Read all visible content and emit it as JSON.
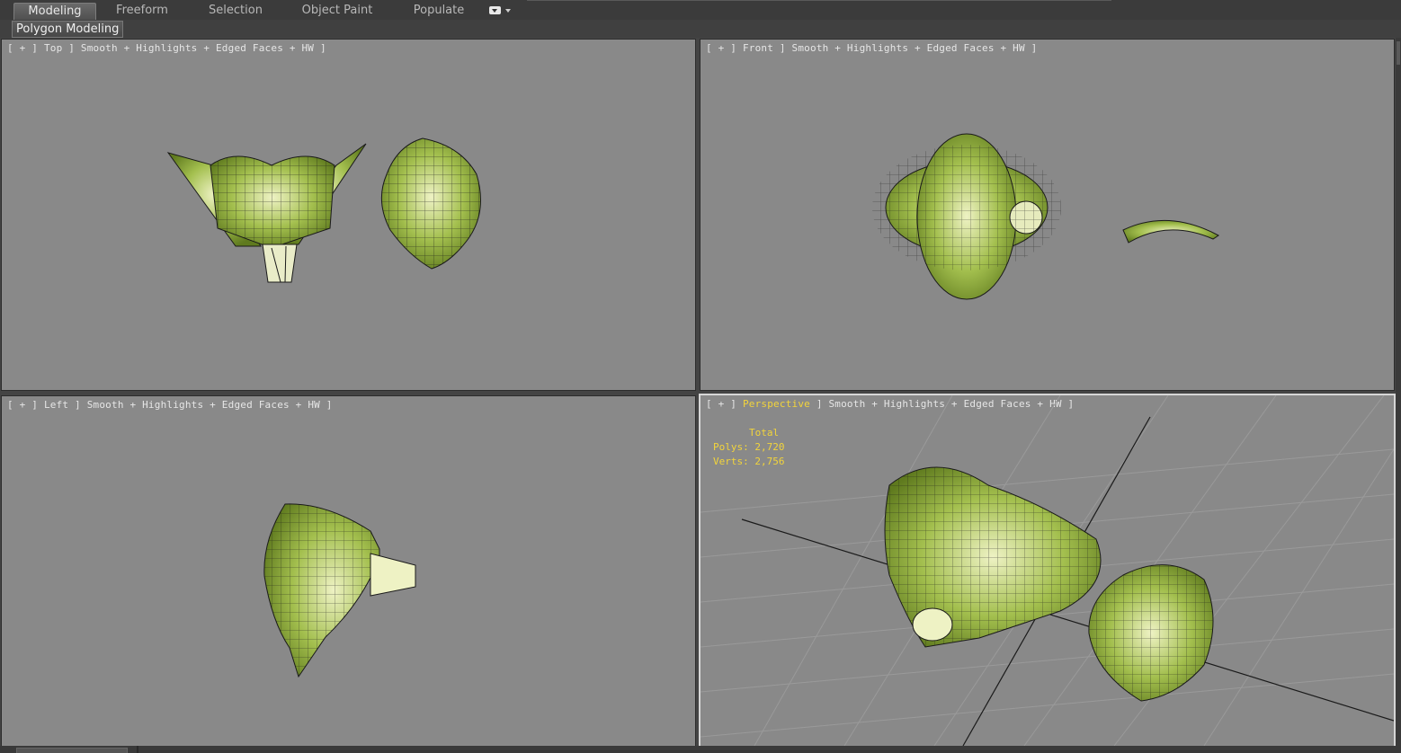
{
  "ribbon": {
    "tabs": [
      {
        "label": "Modeling",
        "active": true
      },
      {
        "label": "Freeform",
        "active": false
      },
      {
        "label": "Selection",
        "active": false
      },
      {
        "label": "Object Paint",
        "active": false
      },
      {
        "label": "Populate",
        "active": false
      }
    ],
    "dropdown_icon": "dropdown-menu-icon"
  },
  "panel": {
    "label": "Polygon Modeling"
  },
  "viewports": {
    "top": {
      "open": "[ + ] ",
      "view": "Top",
      "shading": " ] Smooth + Highlights + Edged Faces + HW ]"
    },
    "front": {
      "open": "[ + ] ",
      "view": "Front",
      "shading": " ] Smooth + Highlights + Edged Faces + HW ]"
    },
    "left": {
      "open": "[ + ] ",
      "view": "Left",
      "shading": " ] Smooth + Highlights + Edged Faces + HW ]"
    },
    "perspective": {
      "open": "[ + ] ",
      "view": "Perspective",
      "shading": " ] Smooth + Highlights + Edged Faces + HW ]",
      "active": true
    }
  },
  "statistics": {
    "total_label": "Total",
    "polys_label": "Polys:",
    "polys_value": "2,720",
    "verts_label": "Verts:",
    "verts_value": "2,756"
  },
  "colors": {
    "viewport_bg": "#898989",
    "model_green": "#a3bf4e",
    "model_highlight": "#eef2c4",
    "wire": "#1a1a1a",
    "label_highlight": "#f2d43b"
  }
}
